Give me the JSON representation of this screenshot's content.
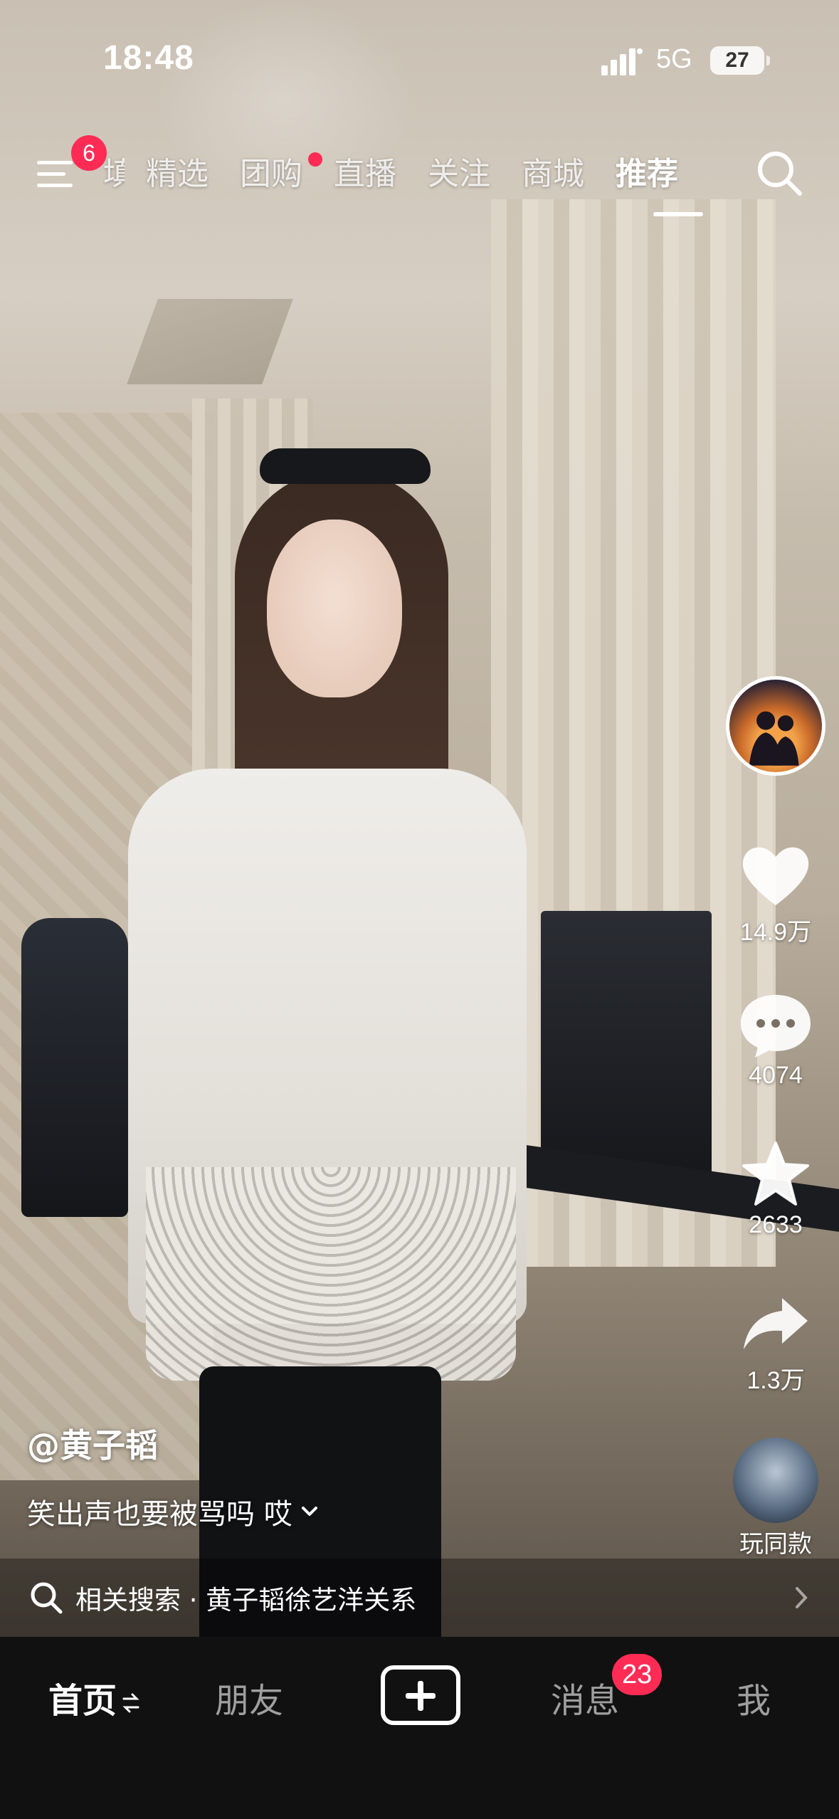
{
  "status_bar": {
    "time": "18:48",
    "network": "5G",
    "battery": "27"
  },
  "top_nav": {
    "menu_badge": "6",
    "tabs": [
      {
        "label": "填"
      },
      {
        "label": "精选"
      },
      {
        "label": "团购"
      },
      {
        "label": "直播"
      },
      {
        "label": "关注"
      },
      {
        "label": "商城"
      },
      {
        "label": "推荐"
      }
    ],
    "active_tab": "推荐"
  },
  "rail": {
    "likes": "14.9万",
    "comments": "4074",
    "favorites": "2633",
    "shares": "1.3万",
    "same_style": "玩同款"
  },
  "caption": {
    "author": "@黄子韬",
    "description": "笑出声也要被骂吗 哎"
  },
  "related_search": {
    "text": "相关搜索 · 黄子韬徐艺洋关系"
  },
  "bottom_bar": {
    "home": "首页",
    "friends": "朋友",
    "messages": "消息",
    "messages_badge": "23",
    "me": "我"
  },
  "colors": {
    "accent": "#fe2c55",
    "bar_bg": "#111111"
  }
}
